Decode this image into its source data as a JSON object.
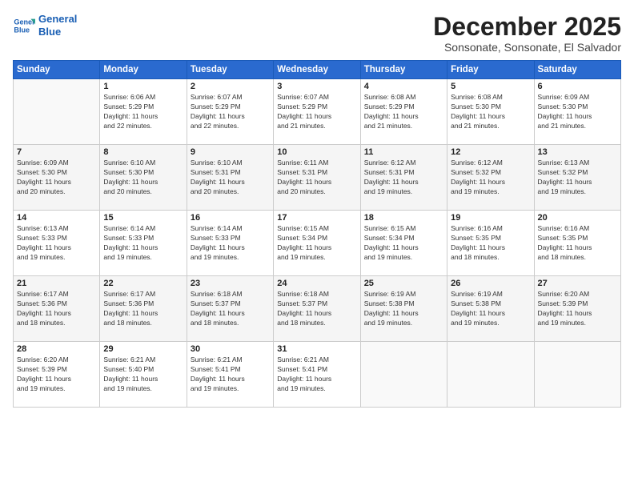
{
  "logo": {
    "line1": "General",
    "line2": "Blue"
  },
  "title": "December 2025",
  "subtitle": "Sonsonate, Sonsonate, El Salvador",
  "days_header": [
    "Sunday",
    "Monday",
    "Tuesday",
    "Wednesday",
    "Thursday",
    "Friday",
    "Saturday"
  ],
  "weeks": [
    [
      {
        "num": "",
        "info": ""
      },
      {
        "num": "1",
        "info": "Sunrise: 6:06 AM\nSunset: 5:29 PM\nDaylight: 11 hours\nand 22 minutes."
      },
      {
        "num": "2",
        "info": "Sunrise: 6:07 AM\nSunset: 5:29 PM\nDaylight: 11 hours\nand 22 minutes."
      },
      {
        "num": "3",
        "info": "Sunrise: 6:07 AM\nSunset: 5:29 PM\nDaylight: 11 hours\nand 21 minutes."
      },
      {
        "num": "4",
        "info": "Sunrise: 6:08 AM\nSunset: 5:29 PM\nDaylight: 11 hours\nand 21 minutes."
      },
      {
        "num": "5",
        "info": "Sunrise: 6:08 AM\nSunset: 5:30 PM\nDaylight: 11 hours\nand 21 minutes."
      },
      {
        "num": "6",
        "info": "Sunrise: 6:09 AM\nSunset: 5:30 PM\nDaylight: 11 hours\nand 21 minutes."
      }
    ],
    [
      {
        "num": "7",
        "info": "Sunrise: 6:09 AM\nSunset: 5:30 PM\nDaylight: 11 hours\nand 20 minutes."
      },
      {
        "num": "8",
        "info": "Sunrise: 6:10 AM\nSunset: 5:30 PM\nDaylight: 11 hours\nand 20 minutes."
      },
      {
        "num": "9",
        "info": "Sunrise: 6:10 AM\nSunset: 5:31 PM\nDaylight: 11 hours\nand 20 minutes."
      },
      {
        "num": "10",
        "info": "Sunrise: 6:11 AM\nSunset: 5:31 PM\nDaylight: 11 hours\nand 20 minutes."
      },
      {
        "num": "11",
        "info": "Sunrise: 6:12 AM\nSunset: 5:31 PM\nDaylight: 11 hours\nand 19 minutes."
      },
      {
        "num": "12",
        "info": "Sunrise: 6:12 AM\nSunset: 5:32 PM\nDaylight: 11 hours\nand 19 minutes."
      },
      {
        "num": "13",
        "info": "Sunrise: 6:13 AM\nSunset: 5:32 PM\nDaylight: 11 hours\nand 19 minutes."
      }
    ],
    [
      {
        "num": "14",
        "info": "Sunrise: 6:13 AM\nSunset: 5:33 PM\nDaylight: 11 hours\nand 19 minutes."
      },
      {
        "num": "15",
        "info": "Sunrise: 6:14 AM\nSunset: 5:33 PM\nDaylight: 11 hours\nand 19 minutes."
      },
      {
        "num": "16",
        "info": "Sunrise: 6:14 AM\nSunset: 5:33 PM\nDaylight: 11 hours\nand 19 minutes."
      },
      {
        "num": "17",
        "info": "Sunrise: 6:15 AM\nSunset: 5:34 PM\nDaylight: 11 hours\nand 19 minutes."
      },
      {
        "num": "18",
        "info": "Sunrise: 6:15 AM\nSunset: 5:34 PM\nDaylight: 11 hours\nand 19 minutes."
      },
      {
        "num": "19",
        "info": "Sunrise: 6:16 AM\nSunset: 5:35 PM\nDaylight: 11 hours\nand 18 minutes."
      },
      {
        "num": "20",
        "info": "Sunrise: 6:16 AM\nSunset: 5:35 PM\nDaylight: 11 hours\nand 18 minutes."
      }
    ],
    [
      {
        "num": "21",
        "info": "Sunrise: 6:17 AM\nSunset: 5:36 PM\nDaylight: 11 hours\nand 18 minutes."
      },
      {
        "num": "22",
        "info": "Sunrise: 6:17 AM\nSunset: 5:36 PM\nDaylight: 11 hours\nand 18 minutes."
      },
      {
        "num": "23",
        "info": "Sunrise: 6:18 AM\nSunset: 5:37 PM\nDaylight: 11 hours\nand 18 minutes."
      },
      {
        "num": "24",
        "info": "Sunrise: 6:18 AM\nSunset: 5:37 PM\nDaylight: 11 hours\nand 18 minutes."
      },
      {
        "num": "25",
        "info": "Sunrise: 6:19 AM\nSunset: 5:38 PM\nDaylight: 11 hours\nand 19 minutes."
      },
      {
        "num": "26",
        "info": "Sunrise: 6:19 AM\nSunset: 5:38 PM\nDaylight: 11 hours\nand 19 minutes."
      },
      {
        "num": "27",
        "info": "Sunrise: 6:20 AM\nSunset: 5:39 PM\nDaylight: 11 hours\nand 19 minutes."
      }
    ],
    [
      {
        "num": "28",
        "info": "Sunrise: 6:20 AM\nSunset: 5:39 PM\nDaylight: 11 hours\nand 19 minutes."
      },
      {
        "num": "29",
        "info": "Sunrise: 6:21 AM\nSunset: 5:40 PM\nDaylight: 11 hours\nand 19 minutes."
      },
      {
        "num": "30",
        "info": "Sunrise: 6:21 AM\nSunset: 5:41 PM\nDaylight: 11 hours\nand 19 minutes."
      },
      {
        "num": "31",
        "info": "Sunrise: 6:21 AM\nSunset: 5:41 PM\nDaylight: 11 hours\nand 19 minutes."
      },
      {
        "num": "",
        "info": ""
      },
      {
        "num": "",
        "info": ""
      },
      {
        "num": "",
        "info": ""
      }
    ]
  ]
}
